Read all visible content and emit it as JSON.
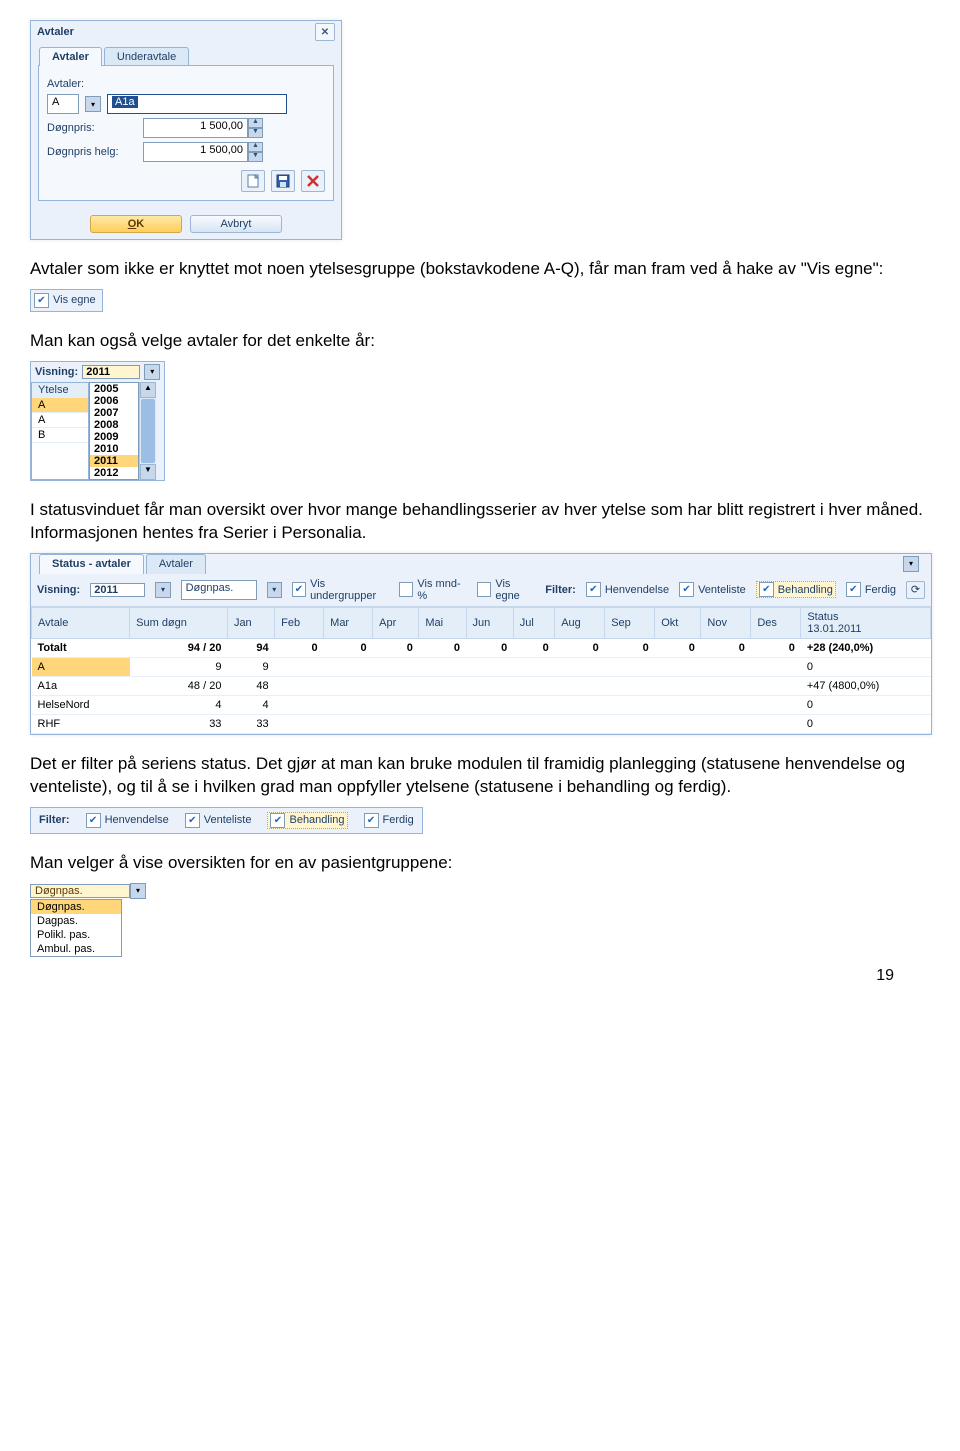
{
  "avtaler_dialog": {
    "title": "Avtaler",
    "tabs": [
      {
        "label": "Avtaler",
        "active": true
      },
      {
        "label": "Underavtale",
        "active": false
      }
    ],
    "fields": {
      "avtaler_label": "Avtaler:",
      "code": "A",
      "name": "A1a",
      "dognpris_label": "Døgnpris:",
      "dognpris": "1 500,00",
      "dognpris_helg_label": "Døgnpris helg:",
      "dognpris_helg": "1 500,00"
    },
    "icons": [
      "new",
      "save",
      "delete"
    ],
    "ok": "OK",
    "cancel": "Avbryt"
  },
  "para1": "Avtaler som ikke er knyttet mot noen ytelsesgruppe (bokstavkodene A-Q), får man fram ved å hake av \"Vis egne\":",
  "vis_egne": {
    "label": "Vis egne",
    "checked": true
  },
  "para2": "Man kan også velge avtaler for det enkelte år:",
  "visning_panel": {
    "label": "Visning:",
    "current_year": "2011",
    "ytelse_header": "Ytelse",
    "ytelser": [
      "A",
      "A",
      "B"
    ],
    "years": [
      "2005",
      "2006",
      "2007",
      "2008",
      "2009",
      "2010",
      "2011",
      "2012"
    ]
  },
  "para3": "I statusvinduet får man oversikt over hvor mange behandlingsserier av hver ytelse som har blitt registrert i hver måned. Informasjonen hentes fra Serier i Personalia.",
  "status_panel": {
    "tabs": [
      {
        "label": "Status - avtaler",
        "active": true
      },
      {
        "label": "Avtaler",
        "active": false
      }
    ],
    "toolbar": {
      "visning_label": "Visning:",
      "year": "2011",
      "group": "Døgnpas.",
      "checks": [
        {
          "label": "Vis undergrupper",
          "checked": true
        },
        {
          "label": "Vis mnd-%",
          "checked": false
        },
        {
          "label": "Vis egne",
          "checked": false
        }
      ],
      "filter_label": "Filter:",
      "filters": [
        {
          "label": "Henvendelse",
          "checked": true
        },
        {
          "label": "Venteliste",
          "checked": true
        },
        {
          "label": "Behandling",
          "checked": true,
          "selected": true
        },
        {
          "label": "Ferdig",
          "checked": true
        }
      ]
    },
    "columns": [
      "Avtale",
      "Sum døgn",
      "Jan",
      "Feb",
      "Mar",
      "Apr",
      "Mai",
      "Jun",
      "Jul",
      "Aug",
      "Sep",
      "Okt",
      "Nov",
      "Des",
      "Status\n13.01.2011"
    ],
    "rows": [
      {
        "cells": [
          "Totalt",
          "94 / 20",
          "94",
          "0",
          "0",
          "0",
          "0",
          "0",
          "0",
          "0",
          "0",
          "0",
          "0",
          "0",
          "+28 (240,0%)"
        ],
        "total": true
      },
      {
        "cells": [
          "A",
          "9",
          "9",
          "",
          "",
          "",
          "",
          "",
          "",
          "",
          "",
          "",
          "",
          "",
          "0"
        ],
        "sel": true
      },
      {
        "cells": [
          "A1a",
          "48 / 20",
          "48",
          "",
          "",
          "",
          "",
          "",
          "",
          "",
          "",
          "",
          "",
          "",
          "+47 (4800,0%)"
        ]
      },
      {
        "cells": [
          "HelseNord",
          "4",
          "4",
          "",
          "",
          "",
          "",
          "",
          "",
          "",
          "",
          "",
          "",
          "",
          "0"
        ]
      },
      {
        "cells": [
          "RHF",
          "33",
          "33",
          "",
          "",
          "",
          "",
          "",
          "",
          "",
          "",
          "",
          "",
          "",
          "0"
        ]
      }
    ]
  },
  "para4": "Det er filter på seriens status. Det gjør at man kan bruke modulen til framidig planlegging (statusene henvendelse og venteliste), og til å se i hvilken grad man oppfyller ytelsene (statusene i behandling og ferdig).",
  "filter_strip": {
    "label": "Filter:",
    "items": [
      {
        "label": "Henvendelse",
        "checked": true
      },
      {
        "label": "Venteliste",
        "checked": true
      },
      {
        "label": "Behandling",
        "checked": true,
        "selected": true
      },
      {
        "label": "Ferdig",
        "checked": true
      }
    ]
  },
  "para5": "Man velger å vise oversikten for en av pasientgruppene:",
  "group_dropdown": {
    "current": "Døgnpas.",
    "options": [
      "Døgnpas.",
      "Dagpas.",
      "Polikl. pas.",
      "Ambul. pas."
    ]
  },
  "page_number": "19"
}
